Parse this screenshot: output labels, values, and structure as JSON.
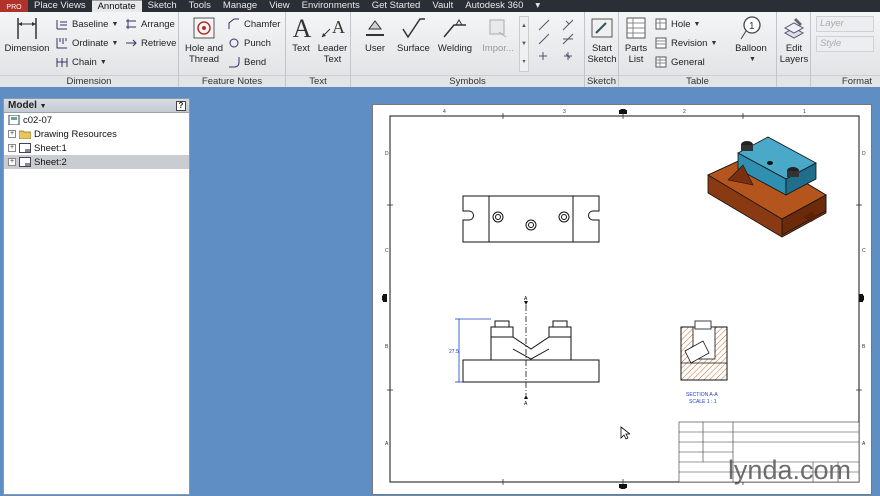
{
  "menubar": {
    "badge": "PRO",
    "tabs": [
      "Place Views",
      "Annotate",
      "Sketch",
      "Tools",
      "Manage",
      "View",
      "Environments",
      "Get Started",
      "Vault",
      "Autodesk 360"
    ],
    "active_tab": "Annotate"
  },
  "ribbon": {
    "dimension": {
      "title": "Dimension",
      "big": "Dimension",
      "baseline": "Baseline",
      "ordinate": "Ordinate",
      "chain": "Chain",
      "arrange": "Arrange",
      "retrieve": "Retrieve"
    },
    "feature_notes": {
      "title": "Feature Notes",
      "hole_line1": "Hole and",
      "hole_line2": "Thread",
      "chamfer": "Chamfer",
      "punch": "Punch",
      "bend": "Bend"
    },
    "text": {
      "title": "Text",
      "text": "Text",
      "leader_line1": "Leader",
      "leader_line2": "Text"
    },
    "symbols": {
      "title": "Symbols",
      "user": "User",
      "surface": "Surface",
      "welding": "Welding",
      "import": "Impor..."
    },
    "sketch": {
      "title": "Sketch",
      "start_line1": "Start",
      "start_line2": "Sketch"
    },
    "table": {
      "title": "Table",
      "parts_line1": "Parts",
      "parts_line2": "List",
      "hole": "Hole",
      "revision": "Revision",
      "general": "General",
      "balloon": "Balloon"
    },
    "edit_layers": {
      "line1": "Edit",
      "line2": "Layers"
    },
    "format": {
      "title": "Format",
      "layer_placeholder": "Layer",
      "style_placeholder": "Style"
    }
  },
  "browser": {
    "header": "Model",
    "help": "?",
    "items": [
      {
        "label": "c02-07",
        "level": 0
      },
      {
        "label": "Drawing Resources",
        "level": 1
      },
      {
        "label": "Sheet:1",
        "level": 1
      },
      {
        "label": "Sheet:2",
        "level": 1
      }
    ]
  },
  "drawing": {
    "section_label": "SECTION A-A",
    "scale_label": "SCALE 1 : 1",
    "cut_label": "A",
    "dim_label": "27.5",
    "border_rows": [
      "D",
      "C",
      "B",
      "A"
    ],
    "border_cols": [
      "4",
      "3",
      "2",
      "1"
    ],
    "colors": {
      "part_body": "#b4551e",
      "part_top": "#2e8fb0",
      "section_line": "#1a3cc4"
    }
  },
  "watermark": {
    "text": "lynda",
    "suffix": ".com"
  }
}
